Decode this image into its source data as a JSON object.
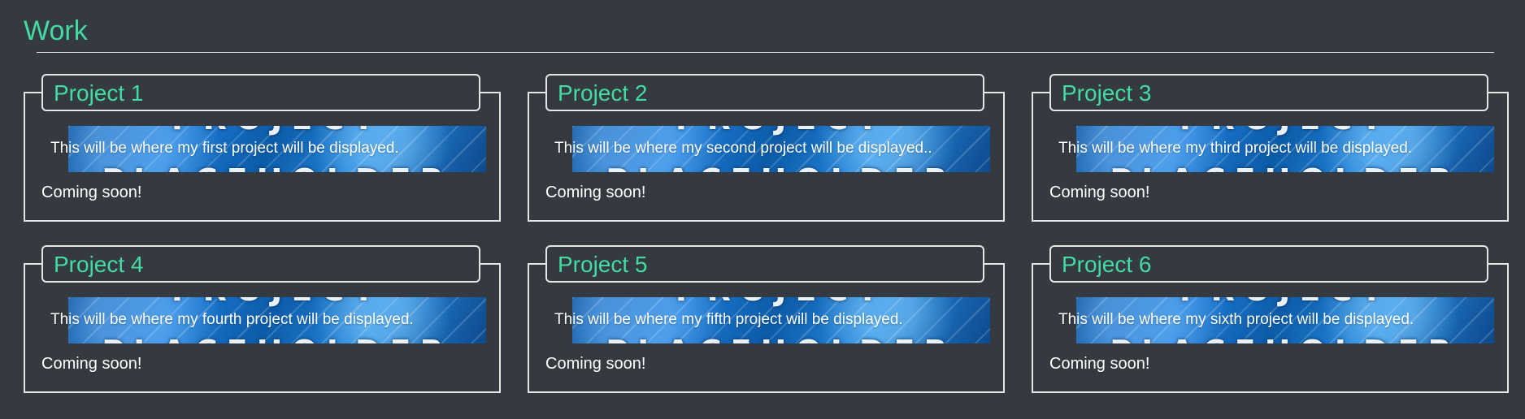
{
  "section": {
    "title": "Work"
  },
  "placeholder_image": {
    "top_text": "PROJECT",
    "bottom_text": "PLACEHOLDER"
  },
  "projects": [
    {
      "title": "Project 1",
      "description": "This will be where my first project will be displayed.",
      "status": "Coming soon!"
    },
    {
      "title": "Project 2",
      "description": "This will be where my second project will be displayed..",
      "status": "Coming soon!"
    },
    {
      "title": "Project 3",
      "description": "This will be where my third project will be displayed.",
      "status": "Coming soon!"
    },
    {
      "title": "Project 4",
      "description": "This will be where my fourth project will be displayed.",
      "status": "Coming soon!"
    },
    {
      "title": "Project 5",
      "description": "This will be where my fifth project will be displayed.",
      "status": "Coming soon!"
    },
    {
      "title": "Project 6",
      "description": "This will be where my sixth project will be displayed.",
      "status": "Coming soon!"
    }
  ],
  "colors": {
    "background": "#343a40",
    "accent": "#42dca3",
    "border": "#e6e6e6",
    "text": "#ffffff",
    "placeholder_blue": "#1d7ad5"
  }
}
